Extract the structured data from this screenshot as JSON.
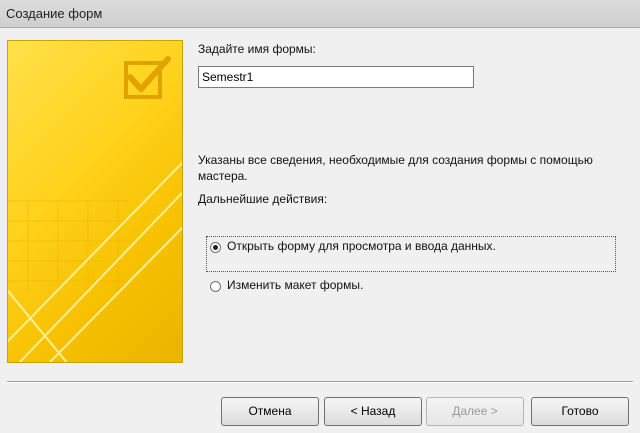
{
  "window": {
    "title": "Создание форм"
  },
  "form_name": {
    "label": "Задайте имя формы:",
    "value": "Semestr1"
  },
  "info": {
    "text": "Указаны все сведения, необходимые для создания формы с помощью мастера."
  },
  "next_actions": {
    "label": "Дальнейшие действия:",
    "options": [
      {
        "label": "Открыть форму для просмотра и ввода данных.",
        "selected": true
      },
      {
        "label": "Изменить макет формы.",
        "selected": false
      }
    ]
  },
  "buttons": {
    "cancel": "Отмена",
    "back": "< Назад",
    "next": "Далее >",
    "finish": "Готово"
  }
}
